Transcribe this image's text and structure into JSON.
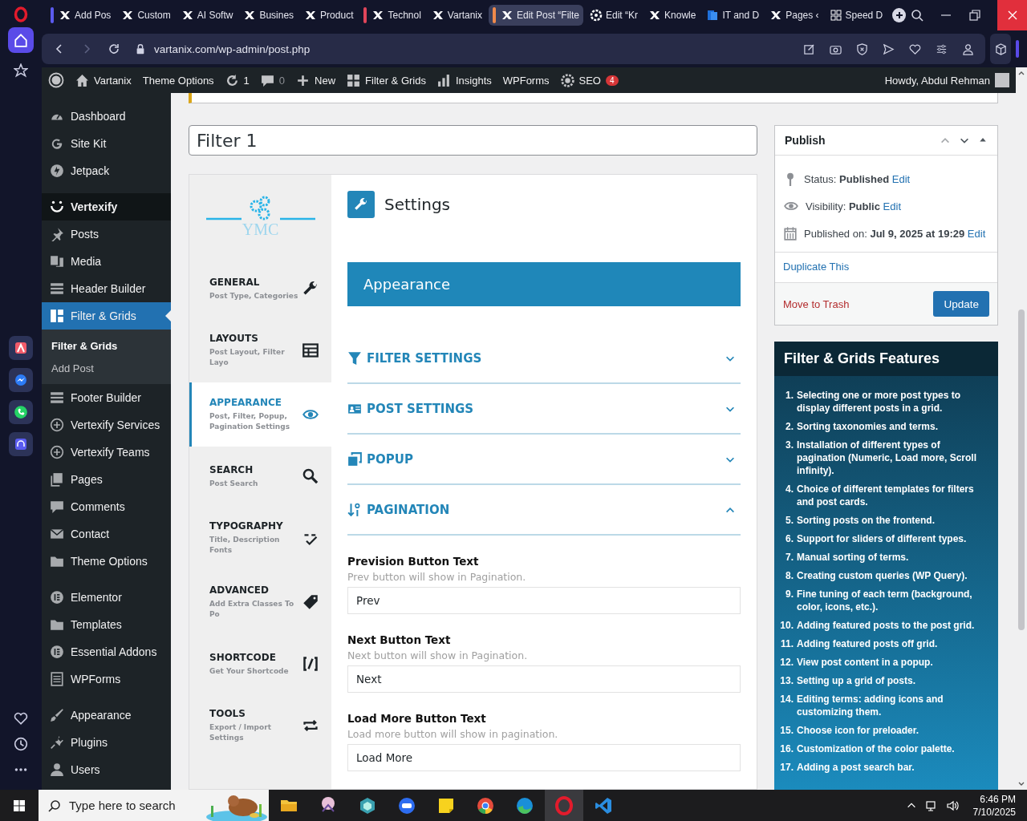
{
  "rail": {
    "buttons": [
      {
        "selected": true
      },
      {
        "selected": false
      }
    ]
  },
  "browser": {
    "tabs": [
      {
        "label": "Add Pos",
        "kind": "x",
        "selected": false,
        "color": "#5b5bf0"
      },
      {
        "label": "Custom",
        "kind": "x",
        "selected": false
      },
      {
        "label": "AI Softw",
        "kind": "x",
        "selected": false
      },
      {
        "label": "Busines",
        "kind": "x",
        "selected": false
      },
      {
        "label": "Product",
        "kind": "x",
        "selected": false
      },
      {
        "label": "Technol",
        "kind": "x",
        "selected": false,
        "color": "#e0455a"
      },
      {
        "label": "Vartanix",
        "kind": "x",
        "selected": false
      },
      {
        "label": "Edit Post “Filte",
        "kind": "x",
        "selected": true,
        "color": "#f08a4b"
      },
      {
        "label": "Edit “Kr",
        "kind": "wp",
        "selected": false
      },
      {
        "label": "Knowle",
        "kind": "x",
        "selected": false
      },
      {
        "label": "IT and D",
        "kind": "doc",
        "selected": false
      },
      {
        "label": "Pages ‹",
        "kind": "x",
        "selected": false
      },
      {
        "label": "Speed D",
        "kind": "grid",
        "selected": false
      }
    ],
    "url": "vartanix.com/wp-admin/post.php"
  },
  "admin_bar": {
    "items": [
      {
        "label": "Vartanix"
      },
      {
        "label": "Theme Options"
      },
      {
        "label": "1"
      },
      {
        "label": "0"
      },
      {
        "label": "New"
      },
      {
        "label": "Filter & Grids"
      },
      {
        "label": "Insights"
      },
      {
        "label": "WPForms"
      },
      {
        "label": "SEO",
        "badge": "4"
      }
    ],
    "account": "Howdy, Abdul Rehman"
  },
  "sidebar": {
    "groups": [
      [
        {
          "label": "Dashboard",
          "kind": "item",
          "selected": false
        },
        {
          "label": "Site Kit",
          "kind": "item",
          "selected": false
        },
        {
          "label": "Jetpack",
          "kind": "item",
          "selected": false
        }
      ],
      [
        {
          "label": "Vertexify",
          "kind": "heading",
          "selected": false
        },
        {
          "label": "Posts",
          "kind": "item",
          "selected": false
        },
        {
          "label": "Media",
          "kind": "item",
          "selected": false
        },
        {
          "label": "Header Builder",
          "kind": "item",
          "selected": false
        },
        {
          "label": "Filter & Grids",
          "kind": "item",
          "selected": true,
          "children": [
            {
              "label": "Filter & Grids",
              "selected": true
            },
            {
              "label": "Add Post",
              "selected": false
            }
          ]
        },
        {
          "label": "Footer Builder",
          "kind": "item",
          "selected": false
        },
        {
          "label": "Vertexify Services",
          "kind": "item",
          "selected": false
        },
        {
          "label": "Vertexify Teams",
          "kind": "item",
          "selected": false
        },
        {
          "label": "Pages",
          "kind": "item",
          "selected": false
        },
        {
          "label": "Comments",
          "kind": "item",
          "selected": false
        },
        {
          "label": "Contact",
          "kind": "item",
          "selected": false
        },
        {
          "label": "Theme Options",
          "kind": "item",
          "selected": false
        }
      ],
      [
        {
          "label": "Elementor",
          "kind": "item",
          "selected": false
        },
        {
          "label": "Templates",
          "kind": "item",
          "selected": false
        },
        {
          "label": "Essential Addons",
          "kind": "item",
          "selected": false
        },
        {
          "label": "WPForms",
          "kind": "item",
          "selected": false
        }
      ],
      [
        {
          "label": "Appearance",
          "kind": "item",
          "selected": false
        },
        {
          "label": "Plugins",
          "kind": "item",
          "selected": false
        },
        {
          "label": "Users",
          "kind": "item",
          "selected": false
        }
      ]
    ]
  },
  "post_title": "Filter 1",
  "plugin": {
    "logo_text": "YMC",
    "tabs": [
      {
        "title": "GENERAL",
        "subtitle": "Post Type, Categories",
        "selected": false
      },
      {
        "title": "LAYOUTS",
        "subtitle": "Post Layout, Filter Layo",
        "selected": false
      },
      {
        "title": "APPEARANCE",
        "subtitle": "Post, Filter, Popup, Pagination Settings",
        "selected": true
      },
      {
        "title": "SEARCH",
        "subtitle": "Post Search",
        "selected": false
      },
      {
        "title": "TYPOGRAPHY",
        "subtitle": "Title, Description Fonts",
        "selected": false
      },
      {
        "title": "ADVANCED",
        "subtitle": "Add Extra Classes To Po",
        "selected": false
      },
      {
        "title": "SHORTCODE",
        "subtitle": "Get Your Shortcode",
        "selected": false
      },
      {
        "title": "TOOLS",
        "subtitle": "Export / Import Settings",
        "selected": false
      }
    ],
    "settings_title": "Settings",
    "section_title": "Appearance",
    "accordions": [
      {
        "label": "FILTER SETTINGS",
        "expanded": false
      },
      {
        "label": "POST SETTINGS",
        "expanded": false
      },
      {
        "label": "POPUP",
        "expanded": false
      },
      {
        "label": "PAGINATION",
        "expanded": true
      }
    ],
    "fields": [
      {
        "label": "Prevision Button Text",
        "hint": "Prev button will show in Pagination.",
        "value": "Prev"
      },
      {
        "label": "Next Button Text",
        "hint": "Next button will show in Pagination.",
        "value": "Next"
      },
      {
        "label": "Load More Button Text",
        "hint": "Load more button will show in pagination.",
        "value": "Load More"
      }
    ]
  },
  "publish": {
    "title": "Publish",
    "rows": [
      {
        "text": "Status: **Published**",
        "link": "Edit"
      },
      {
        "text": "Visibility: **Public**",
        "link": "Edit"
      },
      {
        "text": "Published on: **Jul 9, 2025 at 19:29**",
        "link": "Edit"
      }
    ],
    "duplicate": "Duplicate This",
    "trash": "Move to Trash",
    "update": "Update"
  },
  "features": {
    "title": "Filter & Grids Features",
    "items": [
      {
        "number": "1.",
        "text": "Selecting one or more post types to display different posts in a grid."
      },
      {
        "number": "2.",
        "text": "Sorting taxonomies and terms."
      },
      {
        "number": "3.",
        "text": "Installation of different types of pagination (Numeric, Load more, Scroll infinity)."
      },
      {
        "number": "4.",
        "text": "Choice of different templates for filters and post cards."
      },
      {
        "number": "5.",
        "text": "Sorting posts on the frontend."
      },
      {
        "number": "6.",
        "text": "Support for sliders of different types."
      },
      {
        "number": "7.",
        "text": "Manual sorting of terms."
      },
      {
        "number": "8.",
        "text": "Creating custom queries (WP Query)."
      },
      {
        "number": "9.",
        "text": "Fine tuning of each term (background, color, icons, etc.)."
      },
      {
        "number": "10.",
        "text": "Adding featured posts to the post grid."
      },
      {
        "number": "11.",
        "text": "Adding featured posts off grid."
      },
      {
        "number": "12.",
        "text": "View post content in a popup."
      },
      {
        "number": "13.",
        "text": "Setting up a grid of posts."
      },
      {
        "number": "14.",
        "text": "Editing terms: adding icons and customizing them."
      },
      {
        "number": "15.",
        "text": "Choose icon for preloader."
      },
      {
        "number": "16.",
        "text": "Customization of the color palette."
      },
      {
        "number": "17.",
        "text": "Adding a post search bar."
      }
    ]
  },
  "taskbar": {
    "search_placeholder": "Type here to search",
    "apps": [
      {
        "selected": false
      },
      {
        "selected": false
      },
      {
        "selected": false
      },
      {
        "selected": false
      },
      {
        "selected": false
      },
      {
        "selected": false
      },
      {
        "selected": false
      },
      {
        "selected": true
      },
      {
        "selected": false
      }
    ],
    "time": "6:46 PM",
    "date": "7/10/2025"
  }
}
